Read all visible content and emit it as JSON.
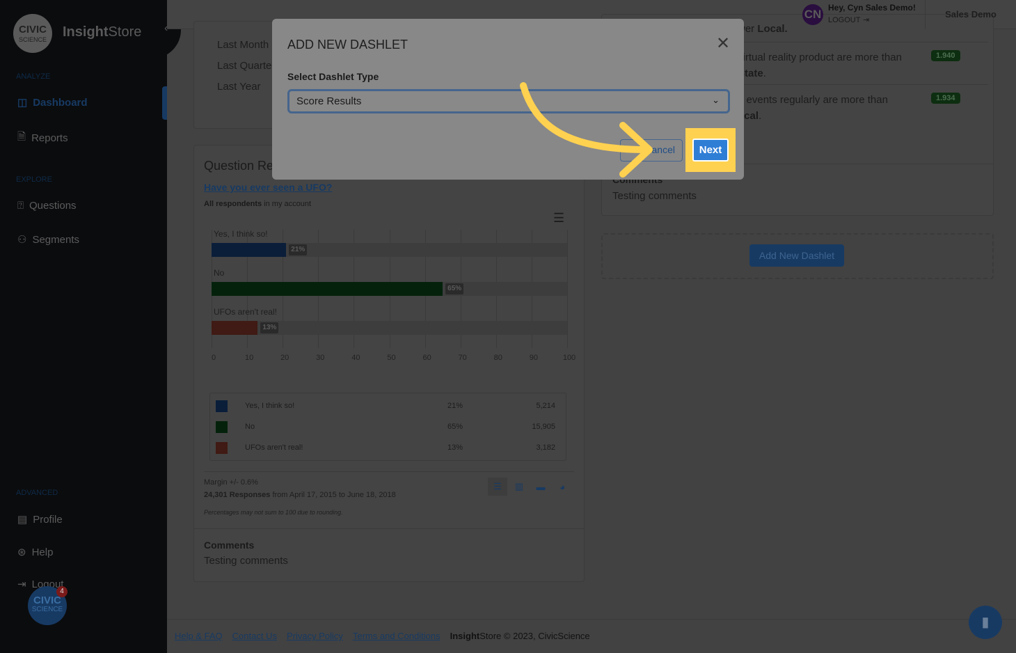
{
  "app": {
    "logo_top": "CIVIC",
    "logo_bottom": "SCIENCE",
    "brand_bold": "Insight",
    "brand_rest": "Store"
  },
  "sidebar": {
    "sections": [
      {
        "label": "ANALYZE"
      },
      {
        "label": "EXPLORE"
      },
      {
        "label": "ADVANCED"
      }
    ],
    "items": [
      {
        "label": "Dashboard",
        "icon": "dashboard-icon",
        "active": true
      },
      {
        "label": "Reports",
        "icon": "report-icon"
      },
      {
        "label": "Questions",
        "icon": "question-icon"
      },
      {
        "label": "Segments",
        "icon": "segments-icon"
      },
      {
        "label": "Profile",
        "icon": "profile-icon"
      },
      {
        "label": "Help",
        "icon": "help-icon"
      },
      {
        "label": "Logout",
        "icon": "logout-icon"
      }
    ],
    "badge_count": "4"
  },
  "header": {
    "avatar": "CN",
    "greeting": "Hey, Cyn Sales Demo!",
    "logout": "LOGOUT",
    "account": "Sales Demo"
  },
  "date_options": [
    "Last Month",
    "Last Quarter",
    "Last Year"
  ],
  "question_card": {
    "title": "Question Results",
    "question": "Have you ever seen a UFO?",
    "scope_bold": "All respondents",
    "scope_rest": " in my account",
    "legend": [
      {
        "label": "Yes, I think so!",
        "pct": "21%",
        "count": "5,214"
      },
      {
        "label": "No",
        "pct": "65%",
        "count": "15,905"
      },
      {
        "label": "UFOs aren't real!",
        "pct": "13%",
        "count": "3,182"
      }
    ],
    "margin": "Margin +/- 0.6%",
    "responses_bold": "24,301 Responses",
    "responses_rest": " from April 17, 2015 to June 18, 2018",
    "note": "Percentages may not sum to 100 due to rounding.",
    "comments_title": "Comments",
    "comments_text": "Testing comments"
  },
  "chart_data": {
    "type": "bar",
    "orientation": "horizontal",
    "categories": [
      "Yes, I think so!",
      "No",
      "UFOs aren't real!"
    ],
    "values": [
      21,
      65,
      13
    ],
    "data_labels": [
      "21%",
      "65%",
      "13%"
    ],
    "colors": [
      "#0a1e3a",
      "#04220b",
      "#401a14"
    ],
    "xlim": [
      0,
      100
    ],
    "xticks": [
      "0",
      "10",
      "20",
      "30",
      "40",
      "50",
      "60",
      "70",
      "80",
      "90",
      "100"
    ],
    "grid": true
  },
  "right_card": {
    "rows": [
      {
        "text_a": "wer ",
        "text_b": "Local."
      },
      {
        "text_a": " virtual reality product are more than",
        "text_b": "State",
        "suffix": ".",
        "score": "1.940"
      },
      {
        "text_a": "g events regularly are more than",
        "text_b": "ocal",
        "suffix": ".",
        "score": "1.934"
      }
    ],
    "comments_title": "Comments",
    "comments_text": "Testing comments"
  },
  "add_dashlet": "Add New Dashlet",
  "modal": {
    "title": "ADD NEW DASHLET",
    "field_label": "Select Dashlet Type",
    "selected": "Score Results",
    "cancel": "Cancel",
    "next": "Next"
  },
  "footer": {
    "links": [
      "Help & FAQ",
      "Contact Us",
      "Privacy Policy",
      "Terms and Conditions"
    ],
    "copy_bold": "Insight",
    "copy_rest": "Store © 2023, CivicScience"
  },
  "colors": {
    "accent": "#2f7ed6",
    "highlight": "#ffd150"
  }
}
